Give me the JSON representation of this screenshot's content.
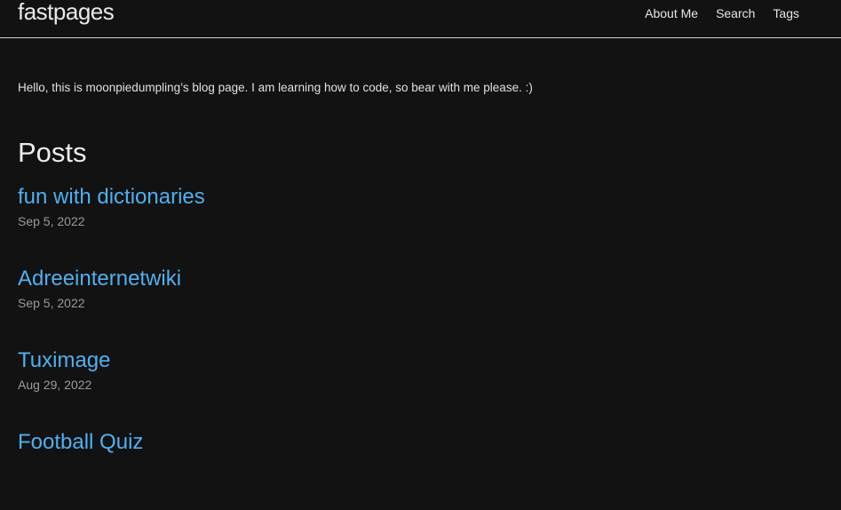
{
  "header": {
    "site_title": "fastpages",
    "nav": [
      "About Me",
      "Search",
      "Tags"
    ]
  },
  "intro": "Hello, this is moonpiedumpling’s blog page. I am learning how to code, so bear with me please. :)",
  "posts_heading": "Posts",
  "posts": [
    {
      "title": "fun with dictionaries",
      "date": "Sep 5, 2022"
    },
    {
      "title": "Adreeinternetwiki",
      "date": "Sep 5, 2022"
    },
    {
      "title": "Tuximage",
      "date": "Aug 29, 2022"
    },
    {
      "title": "Football Quiz",
      "date": ""
    }
  ],
  "colors": {
    "background": "#121212",
    "link": "#4fb0f0",
    "text": "#e0e0e0",
    "muted": "#9a9a9a"
  }
}
